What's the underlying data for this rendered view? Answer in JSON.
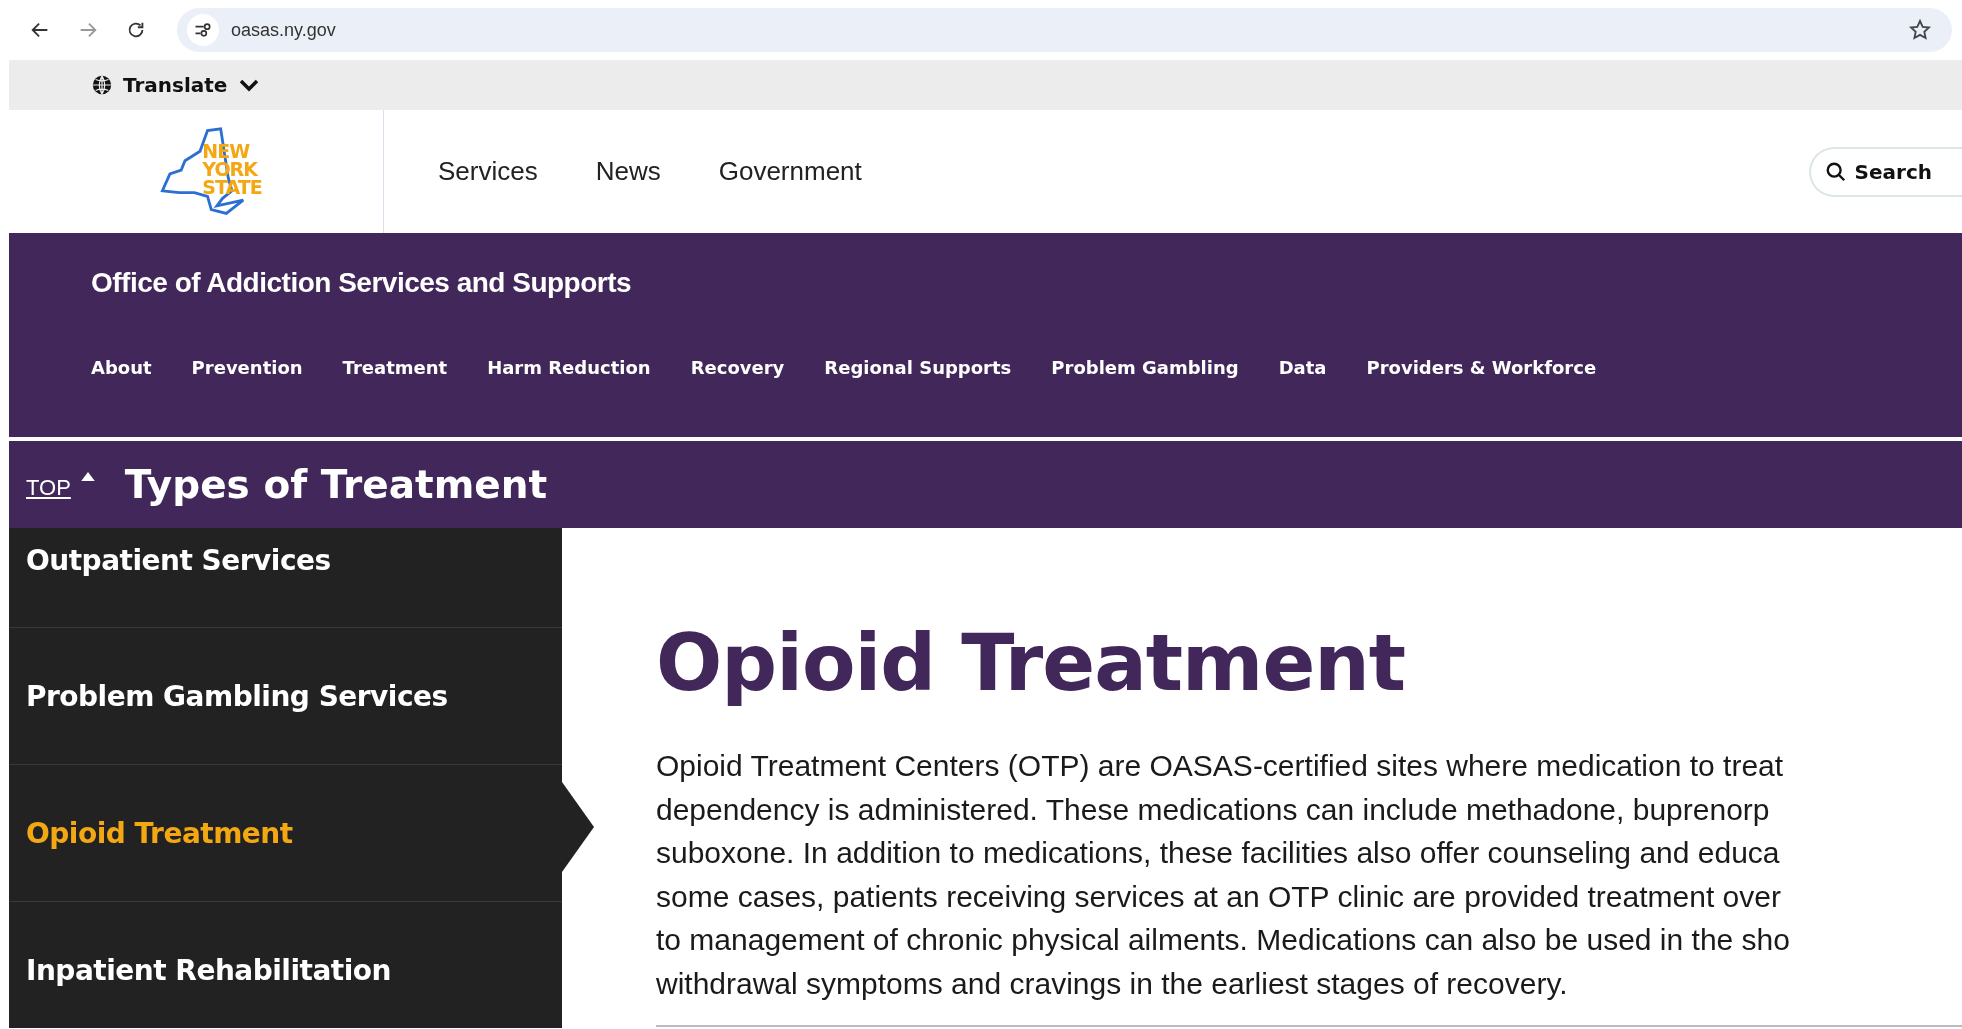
{
  "browser": {
    "url": "oasas.ny.gov"
  },
  "translate": {
    "label": "Translate"
  },
  "header": {
    "logo_lines": [
      "NEW",
      "YORK",
      "STATE"
    ],
    "links": [
      "Services",
      "News",
      "Government"
    ],
    "search": "Search"
  },
  "agency": {
    "title": "Office of Addiction Services and Supports",
    "nav": [
      "About",
      "Prevention",
      "Treatment",
      "Harm Reduction",
      "Recovery",
      "Regional Supports",
      "Problem Gambling",
      "Data",
      "Providers & Workforce"
    ]
  },
  "section_bar": {
    "top_link": "TOP",
    "title": "Types of Treatment"
  },
  "sidebar": {
    "items": [
      {
        "label": "Outpatient Services",
        "selected": false
      },
      {
        "label": "Problem Gambling Services",
        "selected": false
      },
      {
        "label": "Opioid Treatment",
        "selected": true
      },
      {
        "label": "Inpatient Rehabilitation",
        "selected": false
      }
    ]
  },
  "content": {
    "heading": "Opioid Treatment",
    "paragraph_lines": [
      "Opioid Treatment Centers (OTP) are OASAS-certified sites where medication to treat",
      "dependency is administered. These medications can include methadone, buprenorp",
      "suboxone. In addition to medications, these facilities also offer counseling and educa",
      "some cases, patients receiving services at an OTP clinic are provided treatment over",
      "to management of chronic physical ailments. Medications can also be used in the sho",
      "withdrawal symptoms and cravings in the earliest stages of recovery."
    ]
  }
}
